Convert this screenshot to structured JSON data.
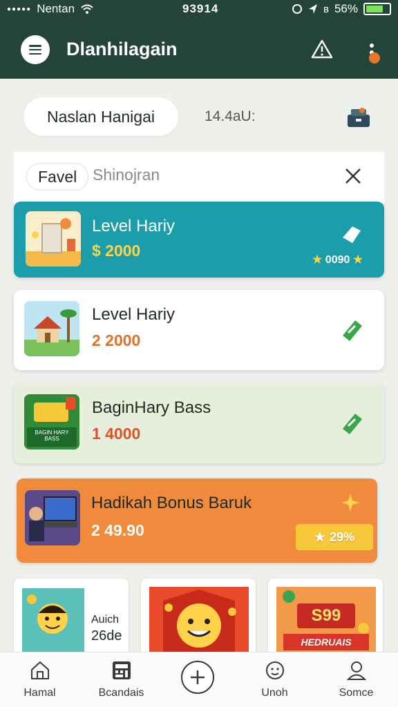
{
  "status_bar": {
    "carrier": "Nentan",
    "time": "93914",
    "battery": "56%"
  },
  "app_bar": {
    "title": "Dlanhilagain"
  },
  "filter": {
    "pill_label": "Naslan Hanigai",
    "count": "14.4aU:"
  },
  "tabs": {
    "active": "Favel",
    "second": "Shinojran"
  },
  "cards": [
    {
      "title": "Level Hariy",
      "amount": "$ 2000",
      "rating": "0090"
    },
    {
      "title": "Level Hariy",
      "amount": "2 2000"
    },
    {
      "title": "BaginHary Bass",
      "amount": "1 4000",
      "thumb_text": "BAGIN HARY BASS"
    },
    {
      "title": "Hadikah Bonus Baruk",
      "amount": "2 49.90",
      "badge": "29%"
    }
  ],
  "promos": [
    {
      "line1": "Auich",
      "line2": "26de"
    },
    {},
    {
      "price": "S99",
      "ribbon": "HEDRUAIS"
    }
  ],
  "bottom_nav": [
    {
      "label": "Hamal",
      "icon": "home-icon"
    },
    {
      "label": "Bcandais",
      "icon": "calculator-icon"
    },
    {
      "label": "",
      "icon": "add-icon"
    },
    {
      "label": "Unoh",
      "icon": "face-icon"
    },
    {
      "label": "Somce",
      "icon": "user-icon"
    }
  ],
  "colors": {
    "header": "#234437",
    "teal_card": "#1c9eaa",
    "orange_card": "#f08a3c",
    "gold": "#ffd24a"
  }
}
